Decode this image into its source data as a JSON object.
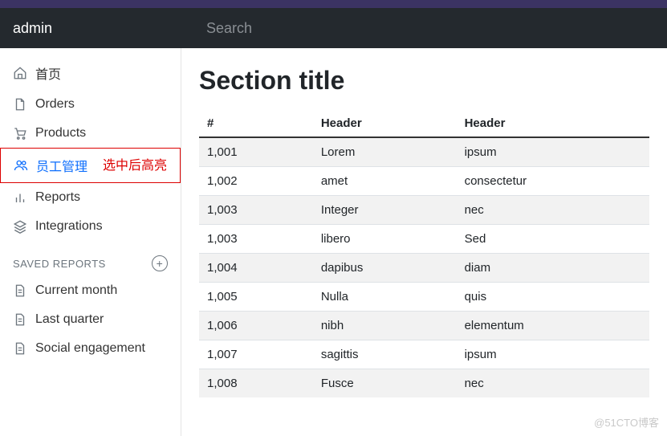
{
  "brand": "admin",
  "search": {
    "placeholder": "Search",
    "value": ""
  },
  "nav": [
    {
      "icon": "home",
      "label": "首页"
    },
    {
      "icon": "file",
      "label": "Orders"
    },
    {
      "icon": "cart",
      "label": "Products"
    },
    {
      "icon": "users",
      "label": "员工管理",
      "active": true,
      "annotation": "选中后高亮"
    },
    {
      "icon": "bar",
      "label": "Reports"
    },
    {
      "icon": "layers",
      "label": "Integrations"
    }
  ],
  "saved_reports": {
    "heading": "SAVED REPORTS",
    "items": [
      {
        "icon": "filetext",
        "label": "Current month"
      },
      {
        "icon": "filetext",
        "label": "Last quarter"
      },
      {
        "icon": "filetext",
        "label": "Social engagement"
      }
    ]
  },
  "main": {
    "title": "Section title",
    "columns": [
      "#",
      "Header",
      "Header"
    ],
    "rows": [
      [
        "1,001",
        "Lorem",
        "ipsum"
      ],
      [
        "1,002",
        "amet",
        "consectetur"
      ],
      [
        "1,003",
        "Integer",
        "nec"
      ],
      [
        "1,003",
        "libero",
        "Sed"
      ],
      [
        "1,004",
        "dapibus",
        "diam"
      ],
      [
        "1,005",
        "Nulla",
        "quis"
      ],
      [
        "1,006",
        "nibh",
        "elementum"
      ],
      [
        "1,007",
        "sagittis",
        "ipsum"
      ],
      [
        "1,008",
        "Fusce",
        "nec"
      ]
    ]
  },
  "watermark": "@51CTO博客"
}
